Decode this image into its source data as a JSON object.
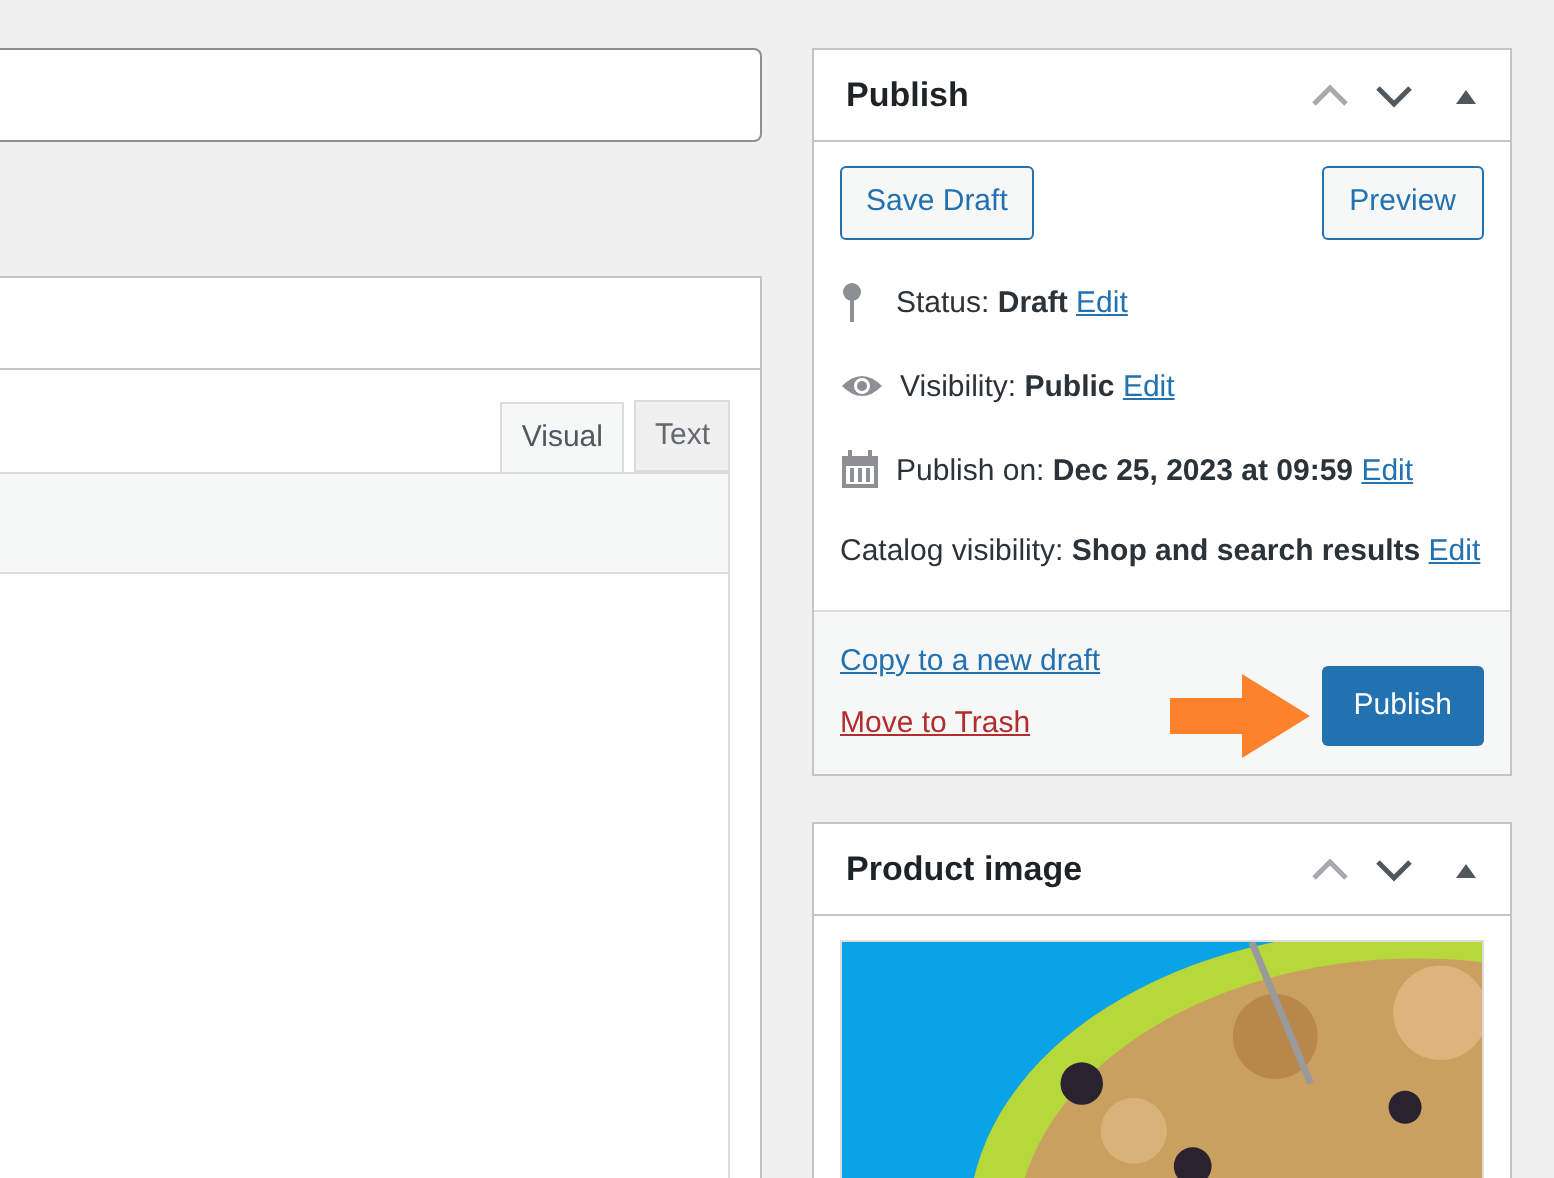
{
  "editor": {
    "tabs": [
      {
        "label": "Visual",
        "selected": true
      },
      {
        "label": "Text",
        "selected": false
      }
    ]
  },
  "publish": {
    "title": "Publish",
    "save_draft": "Save Draft",
    "preview": "Preview",
    "rows": [
      {
        "kind": "status",
        "text": "Status: **Draft**",
        "link": "Edit"
      },
      {
        "kind": "visibility",
        "text": "Visibility: **Public**",
        "link": "Edit"
      },
      {
        "kind": "schedule",
        "text": "Publish on: **Dec 25, 2023 at 09:59**",
        "link": "Edit"
      },
      {
        "kind": "catalog",
        "text": "Catalog visibility: **Shop and search results**",
        "link": "Edit"
      }
    ],
    "copy_link": "Copy to a new draft",
    "trash_link": "Move to Trash",
    "publish_button": "Publish"
  },
  "product_image": {
    "title": "Product image"
  }
}
